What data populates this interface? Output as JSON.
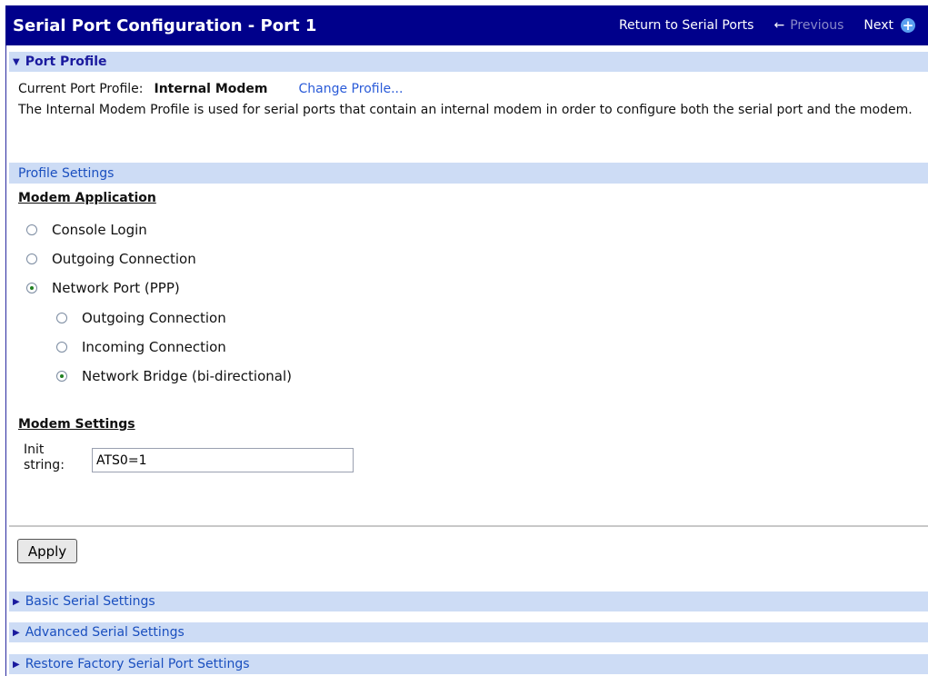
{
  "header": {
    "title": "Serial Port Configuration - Port 1",
    "return_link": "Return to Serial Ports",
    "previous_label": "Previous",
    "next_label": "Next"
  },
  "port_profile": {
    "heading": "Port Profile",
    "current_label": "Current Port Profile:",
    "current_value": "Internal Modem",
    "change_link": "Change Profile...",
    "description": "The Internal Modem Profile is used for serial ports that contain an internal modem in order to configure both the serial port and the modem."
  },
  "profile_settings": {
    "heading": "Profile Settings",
    "modem_application_heading": "Modem Application",
    "options": [
      {
        "label": "Console Login",
        "selected": false
      },
      {
        "label": "Outgoing Connection",
        "selected": false
      },
      {
        "label": "Network Port (PPP)",
        "selected": true
      }
    ],
    "ppp_options": [
      {
        "label": "Outgoing Connection",
        "selected": false
      },
      {
        "label": "Incoming Connection",
        "selected": false
      },
      {
        "label": "Network Bridge (bi-directional)",
        "selected": true
      }
    ],
    "modem_settings_heading": "Modem Settings",
    "init_label_line1": "Init",
    "init_label_line2": "string:",
    "init_value": "ATS0=1"
  },
  "apply_label": "Apply",
  "collapsed_sections": [
    "Basic Serial Settings",
    "Advanced Serial Settings",
    "Restore Factory Serial Port Settings"
  ]
}
